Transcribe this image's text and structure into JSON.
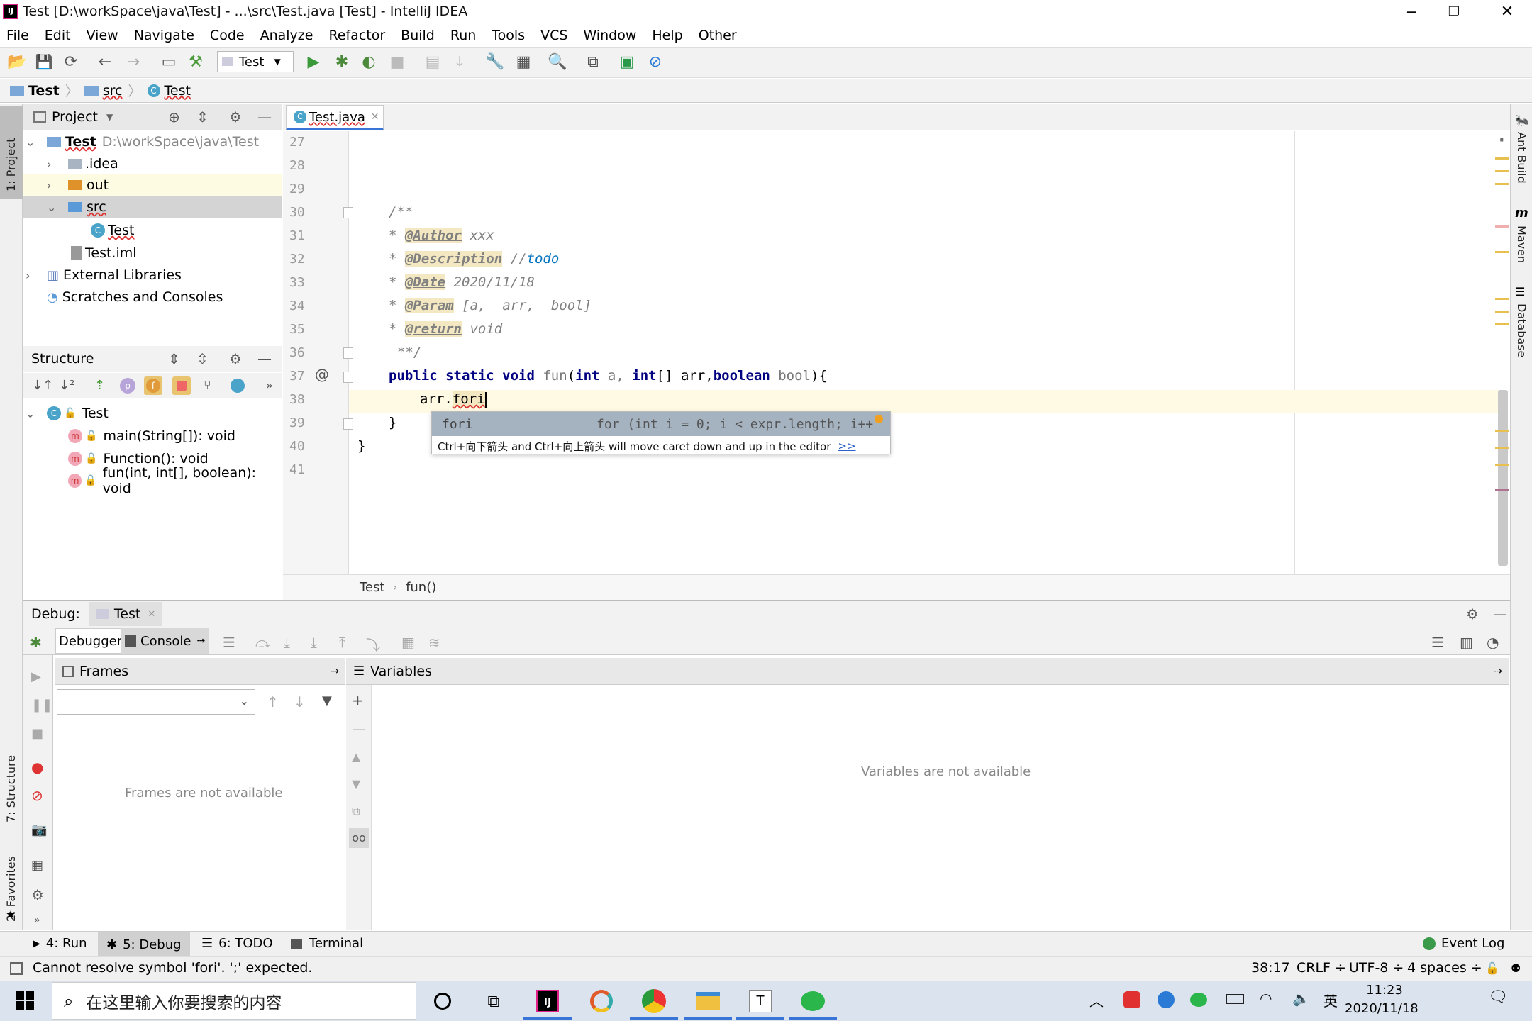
{
  "window": {
    "title": "Test [D:\\workSpace\\java\\Test] - ...\\src\\Test.java [Test] - IntelliJ IDEA"
  },
  "menu": [
    "File",
    "Edit",
    "View",
    "Navigate",
    "Code",
    "Analyze",
    "Refactor",
    "Build",
    "Run",
    "Tools",
    "VCS",
    "Window",
    "Help",
    "Other"
  ],
  "toolbar": {
    "run_config": "Test"
  },
  "breadcrumb": [
    "Test",
    "src",
    "Test"
  ],
  "project_panel": {
    "title": "Project",
    "root_name": "Test",
    "root_path": "D:\\workSpace\\java\\Test",
    "items": [
      ".idea",
      "out",
      "src",
      "Test",
      "Test.iml",
      "External Libraries",
      "Scratches and Consoles"
    ]
  },
  "structure_panel": {
    "title": "Structure",
    "class_name": "Test",
    "members": [
      "main(String[]): void",
      "Function(): void",
      "fun(int, int[], boolean): void"
    ]
  },
  "editor": {
    "tab": "Test.java",
    "line_numbers": [
      "27",
      "28",
      "29",
      "30",
      "31",
      "32",
      "33",
      "34",
      "35",
      "36",
      "37",
      "38",
      "39",
      "40",
      "41"
    ],
    "doc_start": "/**",
    "author_tag": "@Author",
    "author_val": "xxx",
    "desc_tag": "@Description",
    "desc_slash": "//",
    "desc_todo": "todo",
    "date_tag": "@Date",
    "date_val": "2020/11/18",
    "param_tag": "@Param",
    "param_val": "[a,  arr,  bool]",
    "return_tag": "@return",
    "return_val": "void",
    "doc_end": "**/",
    "star": "*",
    "method_kw": "public static void",
    "method_name": "fun",
    "p_int": "int",
    "p_a": "a,",
    "p_int2": "int",
    "p_brackets": "[]",
    "p_arr": "arr,",
    "p_bool": "boolean",
    "p_boolname": "bool",
    "paren_open": "(",
    "paren_close": "){",
    "line38_obj": "arr.",
    "line38_kw": "fori",
    "close_brace1": "}",
    "close_brace2": "}",
    "gutter_at": "@",
    "bottom_crumb": [
      "Test",
      "fun()"
    ]
  },
  "completion": {
    "item": "fori",
    "detail": "for (int i = 0; i < expr.length; i++",
    "hint": "Ctrl+向下箭头 and Ctrl+向上箭头 will move caret down and up in the editor",
    "hint_link": ">>"
  },
  "right_tools": [
    "Ant Build",
    "Maven",
    "Database"
  ],
  "left_tools": [
    "1: Project",
    "7: Structure",
    "2: Favorites"
  ],
  "debug": {
    "label": "Debug:",
    "session_tab": "Test",
    "tabs": [
      "Debugger",
      "Console"
    ],
    "frames_title": "Frames",
    "variables_title": "Variables",
    "frames_empty": "Frames are not available",
    "variables_empty": "Variables are not available"
  },
  "bottom_tools": [
    "4: Run",
    "5: Debug",
    "6: TODO",
    "Terminal"
  ],
  "event_log": "Event Log",
  "status": {
    "message": "Cannot resolve symbol 'fori'. ';' expected.",
    "position": "38:17",
    "line_sep": "CRLF ÷",
    "encoding": "UTF-8 ÷",
    "indent": "4 spaces ÷"
  },
  "taskbar": {
    "search_placeholder": "在这里输入你要搜索的内容",
    "ime": "英",
    "time": "11:23",
    "date": "2020/11/18"
  },
  "colors": {
    "accent": "#3875d6",
    "selection": "#d4d4d4",
    "caret_line": "#fffae3",
    "completion_sel": "#a5b2c0"
  }
}
